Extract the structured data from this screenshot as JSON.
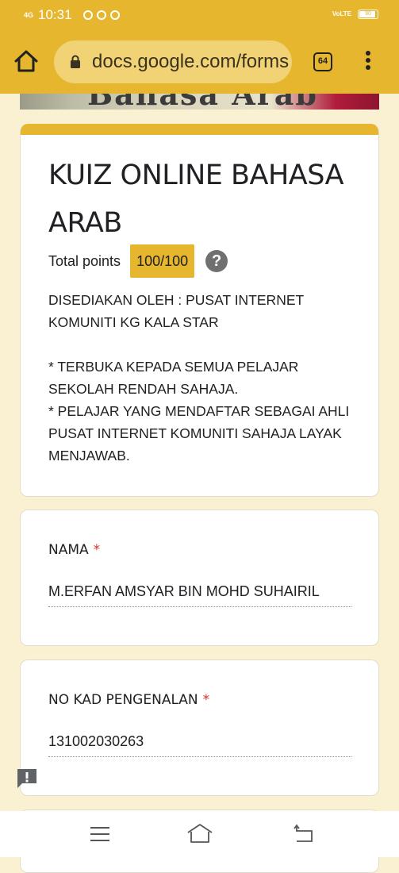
{
  "status_bar": {
    "network": "4G",
    "time": "10:31",
    "volte": "VoLTE",
    "battery": "90",
    "notification_icons": [
      "whatsapp-icon",
      "messenger-icon",
      "app-icon"
    ]
  },
  "browser": {
    "url": "docs.google.com/forms",
    "tab_count": "64"
  },
  "banner": {
    "text": "Bahasa Arab"
  },
  "form": {
    "title": "KUIZ ONLINE BAHASA ARAB",
    "points_label": "Total points",
    "points_value": "100/100",
    "help_icon": "?",
    "description": {
      "line1": "DISEDIAKAN OLEH : PUSAT INTERNET KOMUNITI KG KALA STAR",
      "line2": "* TERBUKA KEPADA SEMUA PELAJAR SEKOLAH RENDAH SAHAJA.",
      "line3": "* PELAJAR YANG MENDAFTAR SEBAGAI AHLI PUSAT INTERNET KOMUNITI SAHAJA LAYAK MENJAWAB."
    }
  },
  "questions": [
    {
      "label": "NAMA",
      "required_mark": "*",
      "answer": "M.ERFAN AMSYAR BIN MOHD SUHAIRIL"
    },
    {
      "label": "NO KAD PENGENALAN",
      "required_mark": "*",
      "answer": "131002030263"
    }
  ],
  "colors": {
    "accent": "#e6b62e",
    "background": "#faf0d2",
    "required": "#d93025"
  }
}
